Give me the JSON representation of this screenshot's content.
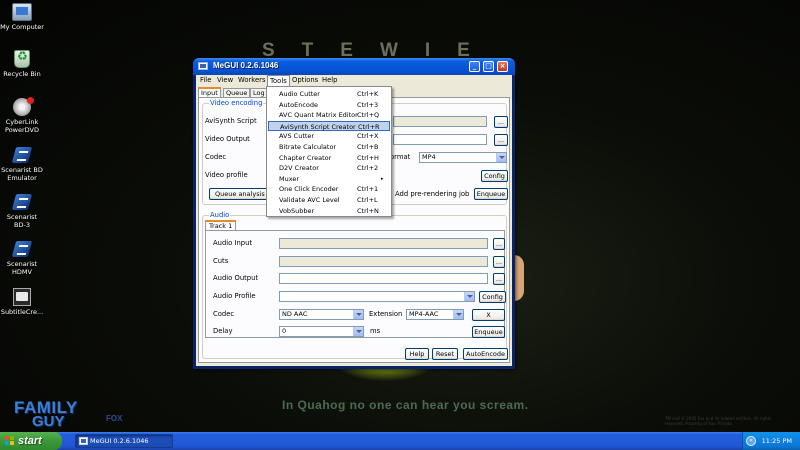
{
  "wallpaper": {
    "title": "STEWIE",
    "tagline": "In Quahog no one can hear you scream.",
    "copyright": "TM and © 2005 Fox and its related entities. All rights reserved. Property of Fox. Private.",
    "logo_family": "FAMILY",
    "logo_guy": "GUY",
    "logo_fox": "FOX"
  },
  "desktop_icons": [
    {
      "label": "My Computer",
      "icon": "my-computer-icon"
    },
    {
      "label": "Recycle Bin",
      "icon": "recycle-bin-icon"
    },
    {
      "label": "CyberLink PowerDVD",
      "icon": "powerdvd-icon"
    },
    {
      "label": "Scenarist BD Emulator",
      "icon": "scenarist-icon"
    },
    {
      "label": "Scenarist BD-3",
      "icon": "scenarist-icon"
    },
    {
      "label": "Scenarist HDMV",
      "icon": "scenarist-icon"
    },
    {
      "label": "SubtitleCre...",
      "icon": "subtitle-creator-icon"
    }
  ],
  "window": {
    "title": "MeGUI 0.2.6.1046",
    "menu": [
      "File",
      "View",
      "Workers",
      "Tools",
      "Options",
      "Help"
    ],
    "tabs": [
      "Input",
      "Queue",
      "Log"
    ],
    "video": {
      "group_label": "Video encoding",
      "avisynth_label": "AviSynth Script",
      "output_label": "Video Output",
      "codec_label": "Codec",
      "format_label": "ormat",
      "format_value": "MP4",
      "profile_label": "Video profile",
      "config_button": "Config",
      "queue_analysis_button": "Queue analysis p",
      "prerender_label": "Add pre-rendering job",
      "enqueue_button": "Enqueue",
      "browse_label": "..."
    },
    "audio": {
      "group_label": "Audio",
      "track_tab": "Track 1",
      "input_label": "Audio Input",
      "cuts_label": "Cuts",
      "output_label": "Audio Output",
      "profile_label": "Audio Profile",
      "config_button": "Config",
      "codec_label": "Codec",
      "codec_value": "ND AAC",
      "extension_label": "Extension",
      "extension_value": "MP4-AAC",
      "x_button": "X",
      "delay_label": "Delay",
      "delay_value": "0",
      "delay_unit": "ms",
      "enqueue_button": "Enqueue",
      "browse_label": "..."
    },
    "bottom_buttons": {
      "help": "Help",
      "reset": "Reset",
      "autoencode": "AutoEncode"
    }
  },
  "tools_menu": [
    {
      "label": "Audio Cutter",
      "shortcut": "Ctrl+K"
    },
    {
      "label": "AutoEncode",
      "shortcut": "Ctrl+3"
    },
    {
      "label": "AVC Quant Matrix Editor",
      "shortcut": "Ctrl+Q"
    },
    {
      "label": "AviSynth Script Creator",
      "shortcut": "Ctrl+R",
      "highlighted": true
    },
    {
      "label": "AVS Cutter",
      "shortcut": "Ctrl+X"
    },
    {
      "label": "Bitrate Calculator",
      "shortcut": "Ctrl+B"
    },
    {
      "label": "Chapter Creator",
      "shortcut": "Ctrl+H"
    },
    {
      "label": "D2V Creator",
      "shortcut": "Ctrl+2"
    },
    {
      "label": "Muxer",
      "shortcut": "",
      "submenu": "▸"
    },
    {
      "label": "One Click Encoder",
      "shortcut": "Ctrl+1"
    },
    {
      "label": "Validate AVC Level",
      "shortcut": "Ctrl+L"
    },
    {
      "label": "VobSubber",
      "shortcut": "Ctrl+N"
    }
  ],
  "taskbar": {
    "start_label": "start",
    "task_label": "MeGUI 0.2.6.1046",
    "tray_chevron": "«",
    "clock": "11:25 PM"
  }
}
